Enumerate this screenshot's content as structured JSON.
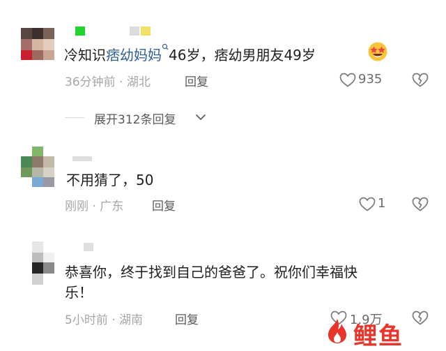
{
  "comments": [
    {
      "text_before": "冷知识",
      "mention": "痞幼妈妈",
      "text_after": "46岁，痞幼男朋友49岁",
      "emoji_icon": "star-struck-emoji-icon",
      "meta": "36分钟前 · 湖北",
      "reply_label": "回复",
      "like_count": "935"
    },
    {
      "text": "不用猜了，50",
      "meta": "刚刚 · 广东",
      "reply_label": "回复",
      "like_count": "1"
    },
    {
      "text_line1": "恭喜你，终于找到自己的爸爸了。祝你们幸福快",
      "text_line2": "乐！",
      "meta": "5小时前 · 湖南",
      "reply_label": "回复",
      "like_count": "1.9万"
    }
  ],
  "expand_replies_label": "展开312条回复",
  "watermark_text": "鲤鱼",
  "colors": {
    "mention": "#2f5f95",
    "meta": "#a6a6a6",
    "watermark": "#e8342a"
  }
}
